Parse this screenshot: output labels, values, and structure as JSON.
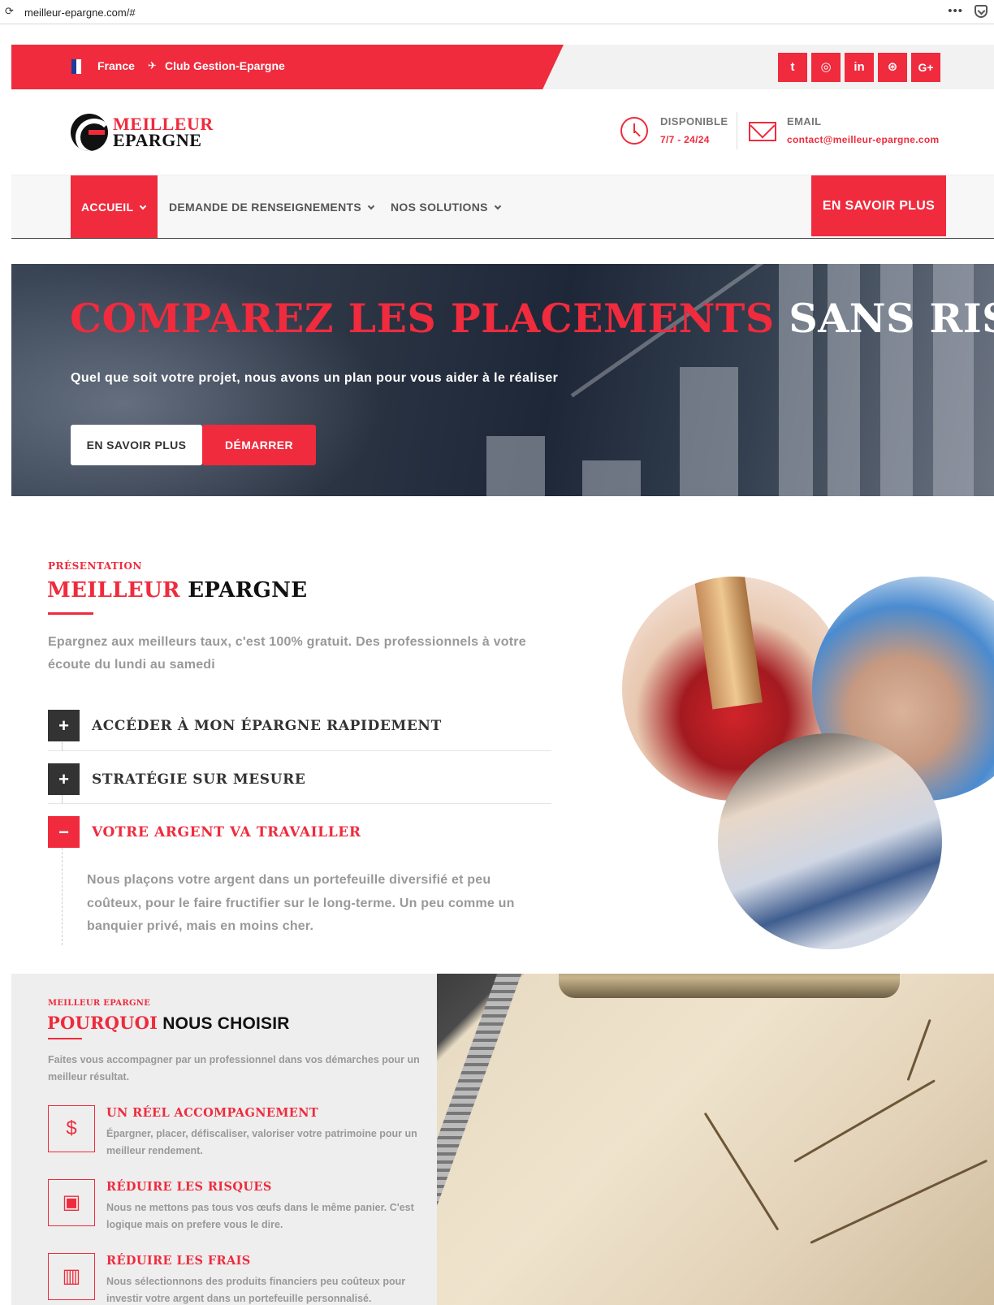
{
  "browser": {
    "url": "meilleur-epargne.com/#",
    "menu_dots": "•••"
  },
  "topbar": {
    "country": "France",
    "club": "Club Gestion-Epargne",
    "club_icon": "paper-plane-icon",
    "social": [
      {
        "name": "twitter",
        "glyph": "t"
      },
      {
        "name": "instagram",
        "glyph": "◎"
      },
      {
        "name": "linkedin",
        "glyph": "in"
      },
      {
        "name": "dribbble",
        "glyph": "⊛"
      },
      {
        "name": "google-plus",
        "glyph": "G+"
      }
    ],
    "colors": {
      "accent": "#ef2b3d"
    }
  },
  "header": {
    "logo_line1": "MEILLEUR",
    "logo_line2": "EPARGNE",
    "availability_label": "DISPONIBLE",
    "availability_value": "7/7 - 24/24",
    "email_label": "EMAIL",
    "email_value": "contact@meilleur-epargne.com"
  },
  "nav": {
    "items": [
      {
        "label": "ACCUEIL",
        "active": true
      },
      {
        "label": "DEMANDE DE RENSEIGNEMENTS",
        "active": false
      },
      {
        "label": "NOS SOLUTIONS",
        "active": false
      }
    ],
    "cta": "EN SAVOIR PLUS"
  },
  "hero": {
    "title_red": "COMPAREZ LES PLACEMENTS",
    "title_white": "SANS RISQUES",
    "subtitle": "Quel que soit votre projet, nous avons un plan pour vous aider à le réaliser",
    "btn_secondary": "EN SAVOIR PLUS",
    "btn_primary": "DÉMARRER"
  },
  "presentation": {
    "kicker": "PRÉSENTATION",
    "title_red": "MEILLEUR",
    "title_dark": "EPARGNE",
    "description": "Epargnez aux meilleurs taux, c'est 100% gratuit. Des professionnels à votre écoute du lundi au samedi",
    "accordion": [
      {
        "title": "ACCÉDER À MON ÉPARGNE RAPIDEMENT",
        "open": false,
        "symbol": "+"
      },
      {
        "title": "STRATÉGIE SUR MESURE",
        "open": false,
        "symbol": "+"
      },
      {
        "title": "VOTRE ARGENT VA TRAVAILLER",
        "open": true,
        "symbol": "−",
        "body": "Nous plaçons votre argent dans un portefeuille diversifié et peu coûteux, pour le faire fructifier sur le long-terme. Un peu comme un banquier privé, mais en moins cher."
      }
    ]
  },
  "why": {
    "kicker": "MEILLEUR EPARGNE",
    "title_red": "POURQUOI",
    "title_dark": "NOUS CHOISIR",
    "description": "Faites vous accompagner par un professionnel dans vos démarches pour un meilleur résultat.",
    "features": [
      {
        "icon": "currency-exchange-icon",
        "glyph": "$",
        "title": "UN RÉEL ACCOMPAGNEMENT",
        "text": "Épargner, placer, défiscaliser, valoriser votre patrimoine pour un meilleur rendement."
      },
      {
        "icon": "monitor-settings-icon",
        "glyph": "▣",
        "title": "RÉDUIRE LES RISQUES",
        "text": "Nous ne mettons pas tous vos œufs dans le même panier. C'est logique mais on prefere vous le dire."
      },
      {
        "icon": "chart-coins-icon",
        "glyph": "▥",
        "title": "RÉDUIRE LES FRAIS",
        "text": "Nous sélectionnons des produits financiers peu coûteux pour investir votre argent dans un portefeuille personnalisé."
      }
    ]
  }
}
